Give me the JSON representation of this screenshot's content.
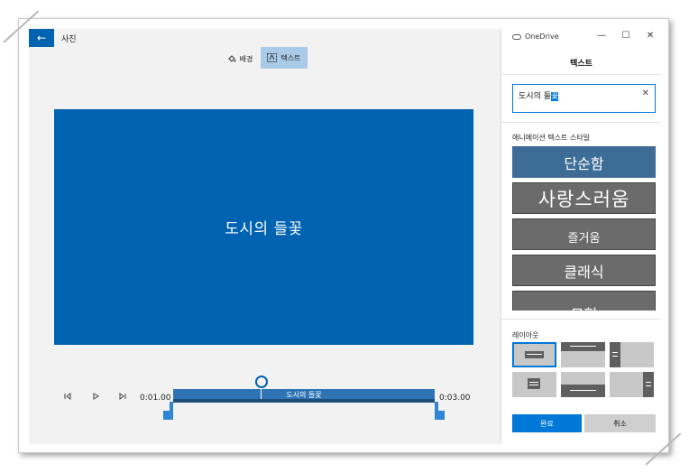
{
  "app": {
    "title": "사진",
    "back_icon": "←"
  },
  "toolbar": {
    "background_label": "배경",
    "text_label": "텍스트"
  },
  "canvas": {
    "text": "도시의 들꽃",
    "color": "#0063b1"
  },
  "playback": {
    "start_time": "0:01.00",
    "end_time": "0:03.00",
    "clip_label": "도시의 들꽃"
  },
  "window": {
    "onedrive_label": "OneDrive",
    "minimize": "—",
    "maximize": "☐",
    "close": "✕"
  },
  "panel": {
    "title": "텍스트",
    "input_value_plain": "도시의 들",
    "input_value_selected": "꽃",
    "clear_icon": "✕",
    "styles_heading": "애니메이션 텍스트 스타일",
    "styles": [
      {
        "label": "단순함",
        "selected": true
      },
      {
        "label": "사랑스러움",
        "selected": false
      },
      {
        "label": "즐거움",
        "selected": false
      },
      {
        "label": "클래식",
        "selected": false
      },
      {
        "label": "모험",
        "selected": false
      }
    ],
    "layout_heading": "레이아웃",
    "done_label": "완료",
    "cancel_label": "취소"
  },
  "colors": {
    "accent": "#0078d7",
    "selected_style": "#3d6c97",
    "style_tile": "#6b6b6b"
  }
}
